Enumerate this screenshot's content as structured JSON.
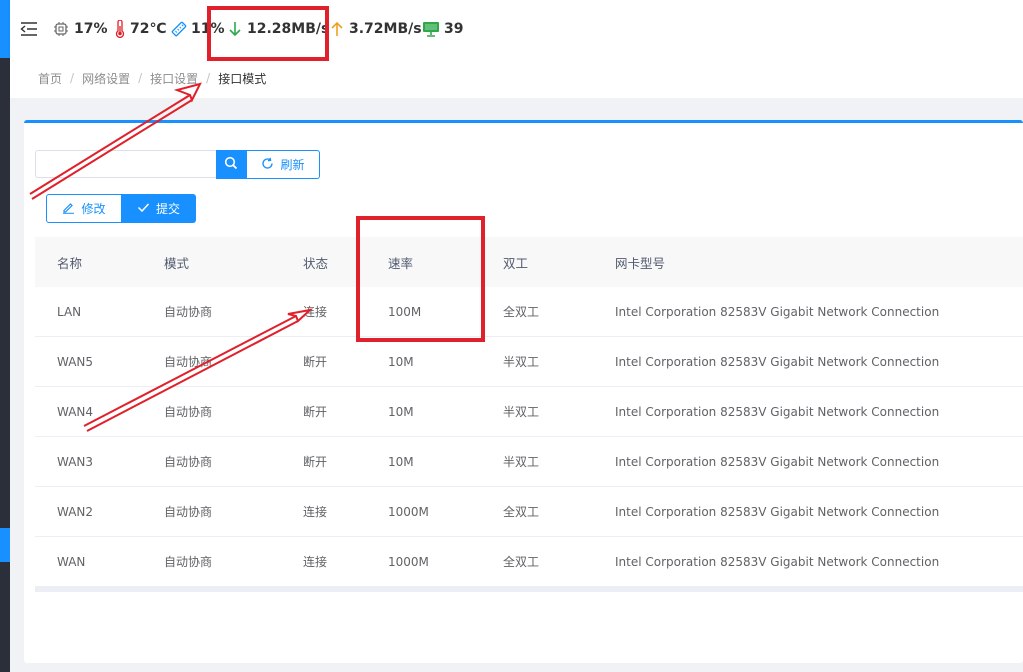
{
  "topbar": {
    "menu_icon": "menu-fold-icon",
    "cpu": {
      "icon": "cpu-chip-icon",
      "value": "17%"
    },
    "temperature": {
      "icon": "thermometer-icon",
      "value": "72℃"
    },
    "memory": {
      "icon": "memory-stick-icon",
      "value": "11%"
    },
    "download": {
      "icon": "arrow-down-icon",
      "value": "12.28MB/s",
      "color": "#2ea84b"
    },
    "upload": {
      "icon": "arrow-up-icon",
      "value": "3.72MB/s",
      "color": "#f0a020"
    },
    "clients": {
      "icon": "monitor-icon",
      "value": "39",
      "color": "#2ea84b"
    }
  },
  "breadcrumb": [
    "首页",
    "网络设置",
    "接口设置",
    "接口模式"
  ],
  "toolbar": {
    "search_placeholder": "",
    "search_icon": "search-icon",
    "refresh_label": "刷新",
    "edit_label": "修改",
    "submit_label": "提交"
  },
  "table": {
    "columns": [
      "名称",
      "模式",
      "状态",
      "速率",
      "双工",
      "网卡型号"
    ],
    "rows": [
      [
        "LAN",
        "自动协商",
        "连接",
        "100M",
        "全双工",
        "Intel Corporation 82583V Gigabit Network Connection"
      ],
      [
        "WAN5",
        "自动协商",
        "断开",
        "10M",
        "半双工",
        "Intel Corporation 82583V Gigabit Network Connection"
      ],
      [
        "WAN4",
        "自动协商",
        "断开",
        "10M",
        "半双工",
        "Intel Corporation 82583V Gigabit Network Connection"
      ],
      [
        "WAN3",
        "自动协商",
        "断开",
        "10M",
        "半双工",
        "Intel Corporation 82583V Gigabit Network Connection"
      ],
      [
        "WAN2",
        "自动协商",
        "连接",
        "1000M",
        "全双工",
        "Intel Corporation 82583V Gigabit Network Connection"
      ],
      [
        "WAN",
        "自动协商",
        "连接",
        "1000M",
        "全双工",
        "Intel Corporation 82583V Gigabit Network Connection"
      ]
    ]
  },
  "colors": {
    "accent": "#1890ff",
    "annotation": "#e0202a"
  }
}
